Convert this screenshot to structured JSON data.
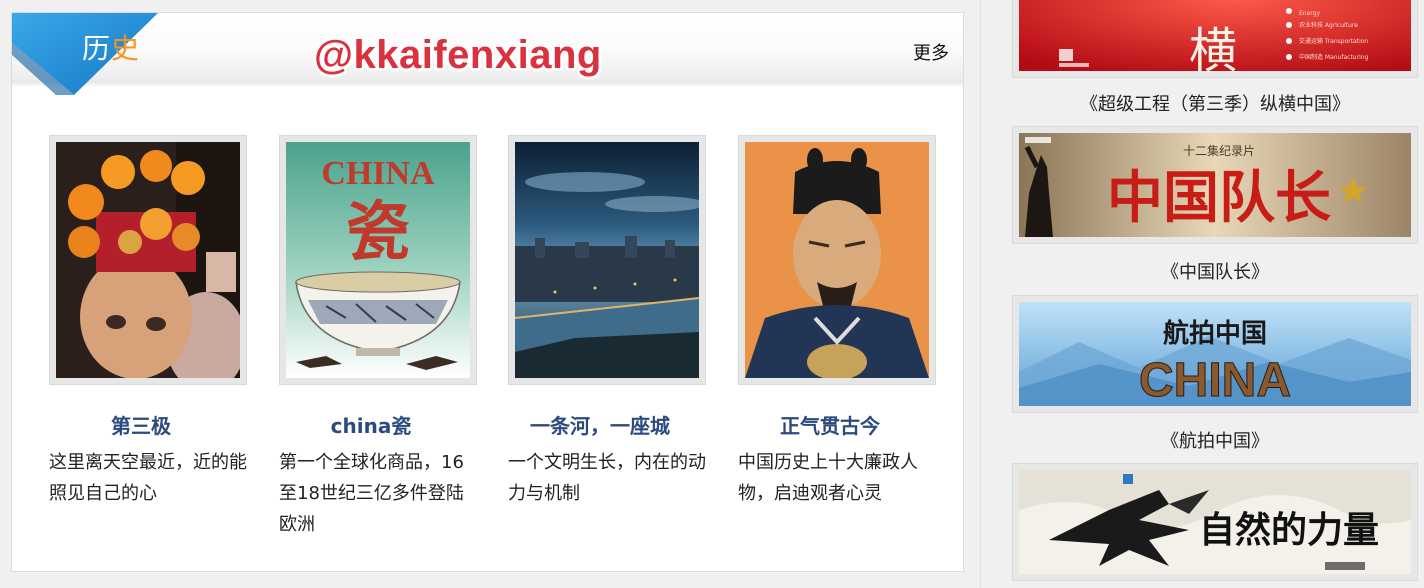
{
  "history_panel": {
    "tab_title_part1": "历",
    "tab_title_part2": "史",
    "watermark": "@kkaifenxiang",
    "more_label": "更多",
    "colors": {
      "flag_blue": "#1e8fd5",
      "title_link": "#2c4a7e",
      "watermark_red": "#d9313e"
    },
    "items": [
      {
        "title": "第三极",
        "desc": "这里离天空最近，近的能照见自己的心",
        "image": "tibetan-child-photo"
      },
      {
        "title": "china瓷",
        "desc": "第一个全球化商品，16至18世纪三亿多件登陆欧洲",
        "image": "china-porcelain-poster"
      },
      {
        "title": "一条河，一座城",
        "desc": "一个文明生长，内在的动力与机制",
        "image": "river-city-night-photo"
      },
      {
        "title": "正气贯古今",
        "desc": "中国历史上十大廉政人物，启迪观者心灵",
        "image": "ancient-official-portrait"
      }
    ],
    "poster_text": {
      "china_word": "CHINA",
      "ci_char": "瓷"
    }
  },
  "sidebar": {
    "items": [
      {
        "caption": "《超级工程（第三季）纵横中国》",
        "banner": {
          "big_char": "横",
          "labels": [
            "Energy",
            "农业科技 Agriculture",
            "交通运输 Transportation",
            "中国制造 Manufacturing"
          ]
        }
      },
      {
        "caption": "《中国队长》",
        "banner": {
          "subtitle": "十二集纪录片",
          "title": "中国队长"
        }
      },
      {
        "caption": "《航拍中国》",
        "banner": {
          "title": "航拍中国",
          "en_title": "CHINA"
        }
      },
      {
        "caption": "",
        "banner": {
          "title": "自然的力量"
        }
      }
    ]
  }
}
